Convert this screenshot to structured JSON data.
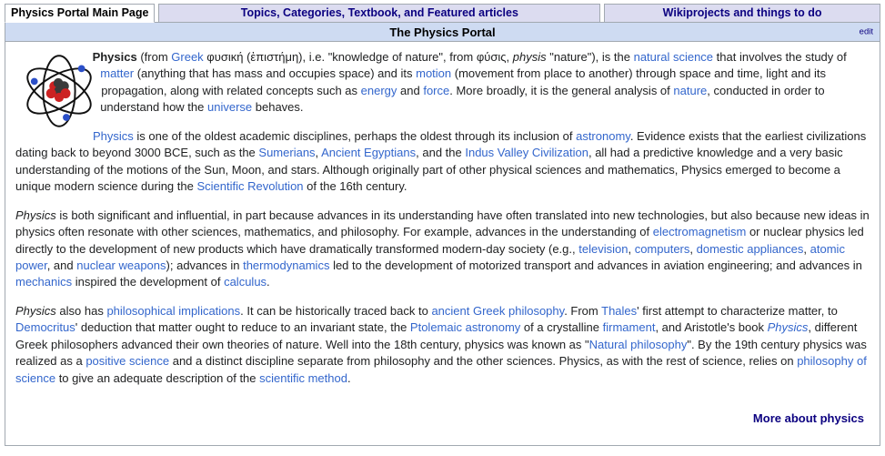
{
  "tabs": [
    {
      "label": "Physics Portal Main Page",
      "active": true
    },
    {
      "label": "Topics, Categories, Textbook, and Featured articles",
      "active": false
    },
    {
      "label": "Wikiprojects and things to do",
      "active": false
    }
  ],
  "header": {
    "title": "The Physics Portal",
    "edit_label": "edit"
  },
  "figure": {
    "icon_name": "atom-icon",
    "nucleus_red": "#cc2222",
    "nucleus_dark": "#3a3a3a",
    "electron_blue": "#2b4fc8",
    "orbit_color": "#111111"
  },
  "colors": {
    "link": "#3366cc",
    "link_dark": "#0b0080",
    "header_bg": "#cedbf2",
    "tab_inactive_bg": "#dcdcf0",
    "border": "#a2a9b1"
  },
  "paragraphs": [
    {
      "id": "p1",
      "runs": [
        {
          "t": "Physics",
          "style": "bold"
        },
        {
          "t": " (from ",
          "style": "plain"
        },
        {
          "t": "Greek",
          "style": "link"
        },
        {
          "t": " φυσική (ἐπιστήμη), i.e. \"knowledge of nature\", from φύσις, ",
          "style": "plain"
        },
        {
          "t": "physis",
          "style": "italic"
        },
        {
          "t": " \"nature\"), is the ",
          "style": "plain"
        },
        {
          "t": "natural science",
          "style": "link"
        },
        {
          "t": " that involves the study of ",
          "style": "plain"
        },
        {
          "t": "matter",
          "style": "link"
        },
        {
          "t": " (anything that has mass and occupies space) and its ",
          "style": "plain"
        },
        {
          "t": "motion",
          "style": "link"
        },
        {
          "t": " (movement from place to another) through space and time, light and its propagation, along with related concepts such as ",
          "style": "plain"
        },
        {
          "t": "energy",
          "style": "link"
        },
        {
          "t": " and ",
          "style": "plain"
        },
        {
          "t": "force",
          "style": "link"
        },
        {
          "t": ". More broadly, it is the general analysis of ",
          "style": "plain"
        },
        {
          "t": "nature",
          "style": "link"
        },
        {
          "t": ", conducted in order to understand how the ",
          "style": "plain"
        },
        {
          "t": "universe",
          "style": "link"
        },
        {
          "t": " behaves.",
          "style": "plain"
        }
      ]
    },
    {
      "id": "p2",
      "indent": true,
      "runs": [
        {
          "t": "Physics",
          "style": "link"
        },
        {
          "t": " is one of the oldest academic disciplines, perhaps the oldest through its inclusion of ",
          "style": "plain"
        },
        {
          "t": "astronomy",
          "style": "link"
        },
        {
          "t": ". Evidence exists that the earliest civilizations dating back to beyond 3000 BCE, such as the ",
          "style": "plain"
        },
        {
          "t": "Sumerians",
          "style": "link"
        },
        {
          "t": ", ",
          "style": "plain"
        },
        {
          "t": "Ancient Egyptians",
          "style": "link"
        },
        {
          "t": ", and the ",
          "style": "plain"
        },
        {
          "t": "Indus Valley Civilization",
          "style": "link"
        },
        {
          "t": ", all had a predictive knowledge and a very basic understanding of the motions of the Sun, Moon, and stars. Although originally part of other physical sciences and mathematics, Physics emerged to become a unique modern science during the ",
          "style": "plain"
        },
        {
          "t": "Scientific Revolution",
          "style": "link"
        },
        {
          "t": " of the 16th century.",
          "style": "plain"
        }
      ]
    },
    {
      "id": "p3",
      "runs": [
        {
          "t": "Physics",
          "style": "italic"
        },
        {
          "t": " is both significant and influential, in part because advances in its understanding have often translated into new technologies, but also because new ideas in physics often resonate with other sciences, mathematics, and philosophy. For example, advances in the understanding of ",
          "style": "plain"
        },
        {
          "t": "electromagnetism",
          "style": "link"
        },
        {
          "t": " or nuclear physics led directly to the development of new products which have dramatically transformed modern-day society (e.g., ",
          "style": "plain"
        },
        {
          "t": "television",
          "style": "link"
        },
        {
          "t": ", ",
          "style": "plain"
        },
        {
          "t": "computers",
          "style": "link"
        },
        {
          "t": ", ",
          "style": "plain"
        },
        {
          "t": "domestic appliances",
          "style": "link"
        },
        {
          "t": ", ",
          "style": "plain"
        },
        {
          "t": "atomic power",
          "style": "link"
        },
        {
          "t": ", and ",
          "style": "plain"
        },
        {
          "t": "nuclear weapons",
          "style": "link"
        },
        {
          "t": "); advances in ",
          "style": "plain"
        },
        {
          "t": "thermodynamics",
          "style": "link"
        },
        {
          "t": " led to the development of motorized transport and advances in aviation engineering; and advances in ",
          "style": "plain"
        },
        {
          "t": "mechanics",
          "style": "link"
        },
        {
          "t": " inspired the development of ",
          "style": "plain"
        },
        {
          "t": "calculus",
          "style": "link"
        },
        {
          "t": ".",
          "style": "plain"
        }
      ]
    },
    {
      "id": "p4",
      "runs": [
        {
          "t": "Physics",
          "style": "italic"
        },
        {
          "t": " also has ",
          "style": "plain"
        },
        {
          "t": "philosophical implications",
          "style": "link"
        },
        {
          "t": ". It can be historically traced back to ",
          "style": "plain"
        },
        {
          "t": "ancient Greek philosophy",
          "style": "link"
        },
        {
          "t": ". From ",
          "style": "plain"
        },
        {
          "t": "Thales",
          "style": "link"
        },
        {
          "t": "' first attempt to characterize matter, to ",
          "style": "plain"
        },
        {
          "t": "Democritus",
          "style": "link"
        },
        {
          "t": "' deduction that matter ought to reduce to an invariant state, the ",
          "style": "plain"
        },
        {
          "t": "Ptolemaic astronomy",
          "style": "link"
        },
        {
          "t": " of a crystalline ",
          "style": "plain"
        },
        {
          "t": "firmament",
          "style": "link"
        },
        {
          "t": ", and Aristotle's book ",
          "style": "plain"
        },
        {
          "t": "Physics",
          "style": "link-italic"
        },
        {
          "t": ", different Greek philosophers advanced their own theories of nature. Well into the 18th century, physics was known as \"",
          "style": "plain"
        },
        {
          "t": "Natural philosophy",
          "style": "link"
        },
        {
          "t": "\". By the 19th century physics was realized as a ",
          "style": "plain"
        },
        {
          "t": "positive science",
          "style": "link"
        },
        {
          "t": " and a distinct discipline separate from philosophy and the other sciences. Physics, as with the rest of science, relies on ",
          "style": "plain"
        },
        {
          "t": "philosophy of science",
          "style": "link"
        },
        {
          "t": " to give an adequate description of the ",
          "style": "plain"
        },
        {
          "t": "scientific method",
          "style": "link"
        },
        {
          "t": ".",
          "style": "plain"
        }
      ]
    }
  ],
  "footer": {
    "more_label": "More about physics"
  }
}
